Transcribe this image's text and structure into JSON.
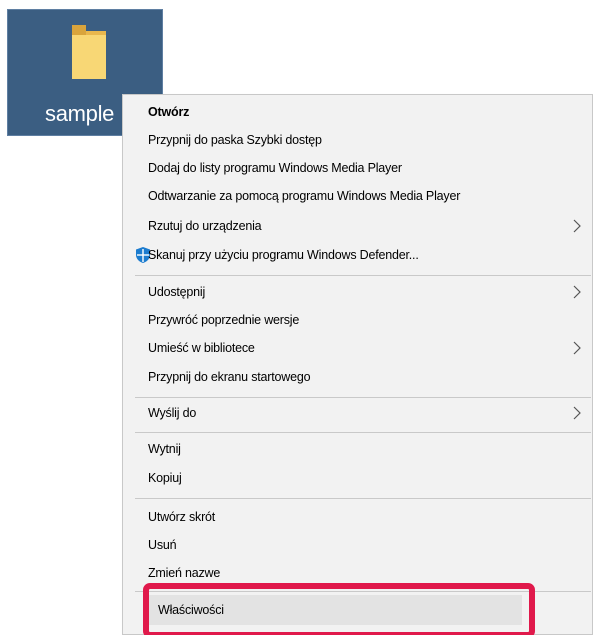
{
  "folder": {
    "name": "sample",
    "icon": "folder-icon"
  },
  "context_menu": {
    "items": [
      {
        "label": "Otwórz",
        "bold": true
      },
      {
        "label": "Przypnij do paska Szybki dostęp"
      },
      {
        "label": "Dodaj do listy programu Windows Media Player"
      },
      {
        "label": "Odtwarzanie za pomocą programu Windows Media Player"
      },
      {
        "label": "Rzutuj do urządzenia",
        "submenu": true
      },
      {
        "label": "Skanuj przy użyciu programu Windows Defender...",
        "icon": "windows-defender-icon"
      },
      {
        "label": "Udostępnij",
        "submenu": true
      },
      {
        "label": "Przywróć poprzednie wersje"
      },
      {
        "label": "Umieść w bibliotece",
        "submenu": true
      },
      {
        "label": "Przypnij do ekranu startowego"
      },
      {
        "label": "Wyślij do",
        "submenu": true
      },
      {
        "label": "Wytnij"
      },
      {
        "label": "Kopiuj"
      },
      {
        "label": "Utwórz skrót"
      },
      {
        "label": "Usuń"
      },
      {
        "label": "Zmień nazwe"
      },
      {
        "label": "Właściwości",
        "highlighted": true
      }
    ]
  },
  "colors": {
    "selection_bg": "#3b5e82",
    "menu_bg": "#f2f2f2",
    "highlight_outline": "#e0194b",
    "defender_blue": "#1c7ccf"
  }
}
